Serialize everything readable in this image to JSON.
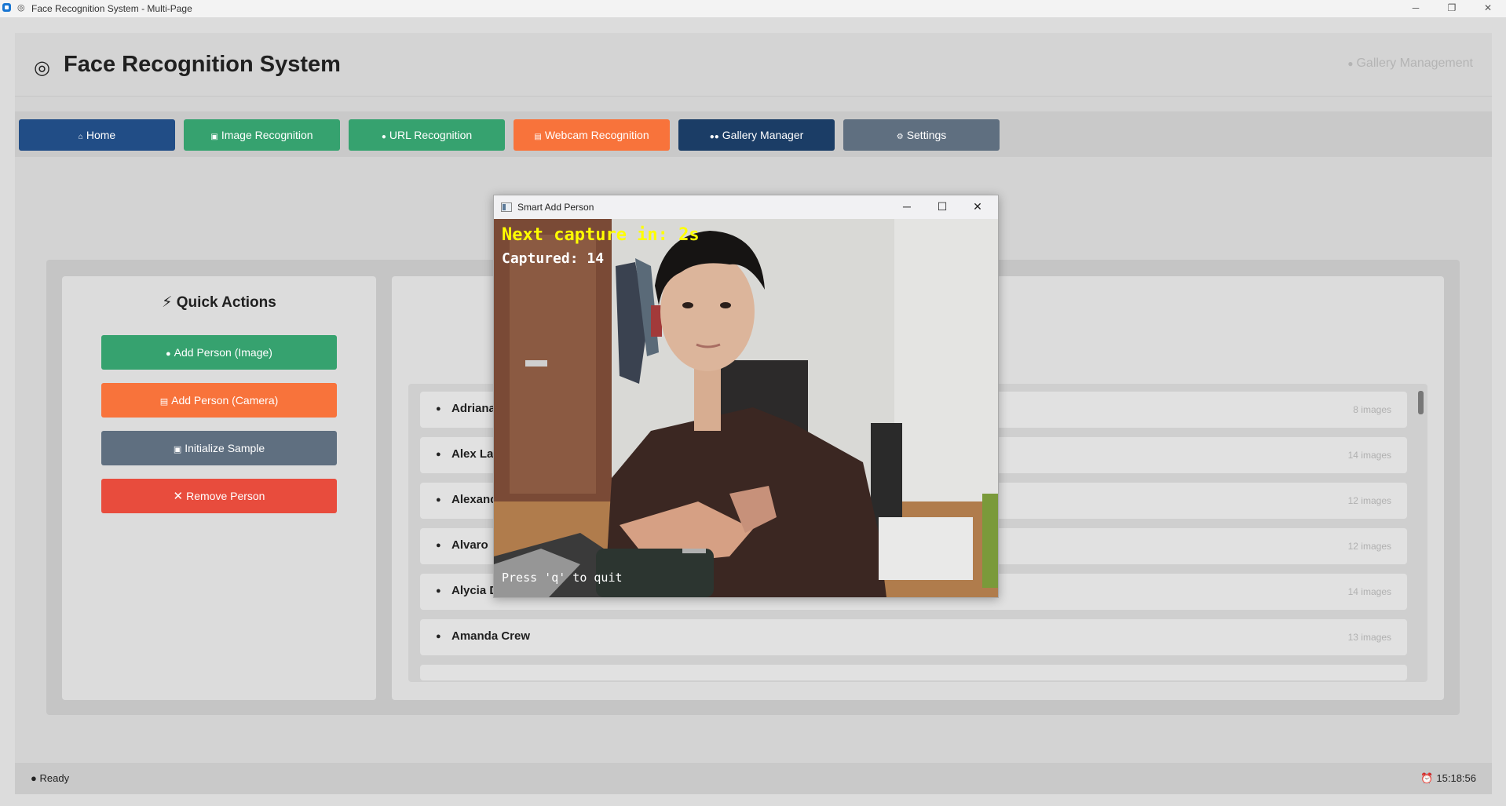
{
  "window": {
    "title": "Face Recognition System - Multi-Page"
  },
  "header": {
    "title": "Face Recognition System",
    "right_label": "Gallery Management"
  },
  "nav": {
    "home": "Home",
    "image": "Image Recognition",
    "url": "URL Recognition",
    "webcam": "Webcam Recognition",
    "gallery": "Gallery Manager",
    "settings": "Settings"
  },
  "quick_actions": {
    "title": "Quick Actions",
    "add_image": "Add Person (Image)",
    "add_camera": "Add Person (Camera)",
    "initialize": "Initialize Sample",
    "remove": "Remove Person"
  },
  "gallery": {
    "people": [
      {
        "name": "Adriana",
        "count": "8 images"
      },
      {
        "name": "Alex La",
        "count": "14 images"
      },
      {
        "name": "Alexand",
        "count": "12 images"
      },
      {
        "name": "Alvaro",
        "count": "12 images"
      },
      {
        "name": "Alycia D",
        "count": "14 images"
      },
      {
        "name": "Amanda Crew",
        "count": "13 images"
      }
    ]
  },
  "status": {
    "left": "Ready",
    "time": "15:18:56"
  },
  "popup": {
    "title": "Smart Add Person",
    "next_capture": "Next capture in: 2s",
    "captured": "Captured: 14",
    "quit_hint": "Press 'q' to quit"
  },
  "colors": {
    "home": "#214d86",
    "green": "#36a26f",
    "orange": "#f8733b",
    "gallery": "#1b3d66",
    "slate": "#5f6f80",
    "red": "#e84c3d",
    "overlay_yellow": "#ffff00"
  },
  "icons": {
    "logo": "target-icon",
    "home": "house-icon",
    "image": "image-icon",
    "url": "globe-icon",
    "webcam": "camera-icon",
    "gallery": "people-icon",
    "settings": "gear-icon",
    "quick": "lightning-icon",
    "person": "person-icon",
    "remove": "close-icon",
    "clock": "alarm-clock-icon"
  }
}
